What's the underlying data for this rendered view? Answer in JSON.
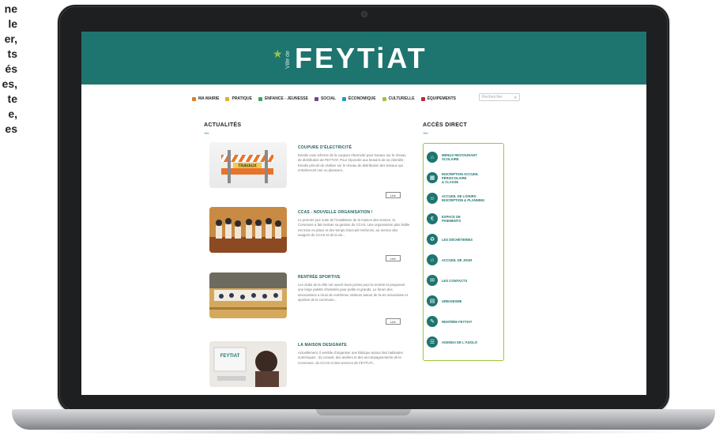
{
  "side_text": [
    "ne",
    "le",
    "er,",
    "ts",
    "és",
    "es,",
    "te",
    "e,",
    "es"
  ],
  "site": {
    "logo_ville": "Ville de",
    "logo_text": "FEYTiAT"
  },
  "nav": {
    "items": [
      {
        "label": "MA MAIRIE",
        "color": "#e07b2a"
      },
      {
        "label": "PRATIQUE",
        "color": "#e0b02a"
      },
      {
        "label": "ENFANCE - JEUNESSE",
        "color": "#3aa55d"
      },
      {
        "label": "SOCIAL",
        "color": "#7b3f8c"
      },
      {
        "label": "ÉCONOMIQUE",
        "color": "#1e9fb0"
      },
      {
        "label": "CULTURELLE",
        "color": "#9bc53d"
      },
      {
        "label": "ÉQUIPEMENTS",
        "color": "#c1272d"
      }
    ],
    "search_placeholder": "Rechercher"
  },
  "news": {
    "title": "ACTUALITÉS",
    "items": [
      {
        "title": "COUPURE D'ÉLECTRICITÉ",
        "excerpt": "Enedis vous informe de la coupure électricité pour travaux sur le réseau de distribution de FEYTIAT. Pour répondre aux besoins de sa clientèle, Enedis prévoit de réaliser sur le réseau de distribution des travaux qui entraîneront une ou plusieurs...",
        "button": "Lire"
      },
      {
        "title": "CCAS - NOUVELLE ORGANISATION !",
        "excerpt": "Le premier jour suite de l'installation de la maison des seniors, la Commune a fait évoluer sa gestion du CCAS. Une organisation plus lisible est mise en place et des temps d'accueil renforcés, au service des usagers du CCAS et de la vie...",
        "button": "Lire"
      },
      {
        "title": "RENTRÉE SPORTIVE",
        "excerpt": "Les clubs de la ville ont ouvert leurs portes pour la rentrée et proposent une large palette d'activités pour petits et grands. Le forum des associations a réuni de nombreux visiteurs autour de la vie associative et sportive de la commune...",
        "button": "Lire"
      },
      {
        "title": "LA MAISON DESIGNATE",
        "excerpt": "Actuellement, il semble d'organiser une fabrique autour des habitudes numériques : du conseil, des ateliers et des accompagnements de la Commune, du CCAS et des services de FEYTIAT...",
        "button": ""
      }
    ]
  },
  "direct_access": {
    "title": "ACCÈS DIRECT",
    "items": [
      {
        "label": "MENUS RESTAURANT\nSCOLAIRE",
        "icon": "restaurant-icon"
      },
      {
        "label": "INSCRIPTION ACCUEIL\nPÉRISCOLAIRE\n& CLASSE",
        "icon": "calendar-icon"
      },
      {
        "label": "ACCUEIL DE LOISIRS\nINSCRIPTION & PLANNING",
        "icon": "people-icon"
      },
      {
        "label": "ESPACE DE\nPAIEMENTS",
        "icon": "payment-icon"
      },
      {
        "label": "LES DÉCHÈTERIES",
        "icon": "recycle-icon"
      },
      {
        "label": "ACCUEIL DE JOUR",
        "icon": "home-icon"
      },
      {
        "label": "LES CONTACTS",
        "icon": "contact-icon"
      },
      {
        "label": "URBANISME",
        "icon": "city-icon"
      },
      {
        "label": "RENTRÉE FEYTIAT",
        "icon": "school-icon"
      },
      {
        "label": "AGENDA DE L'AGGLO",
        "icon": "agenda-icon"
      }
    ]
  }
}
